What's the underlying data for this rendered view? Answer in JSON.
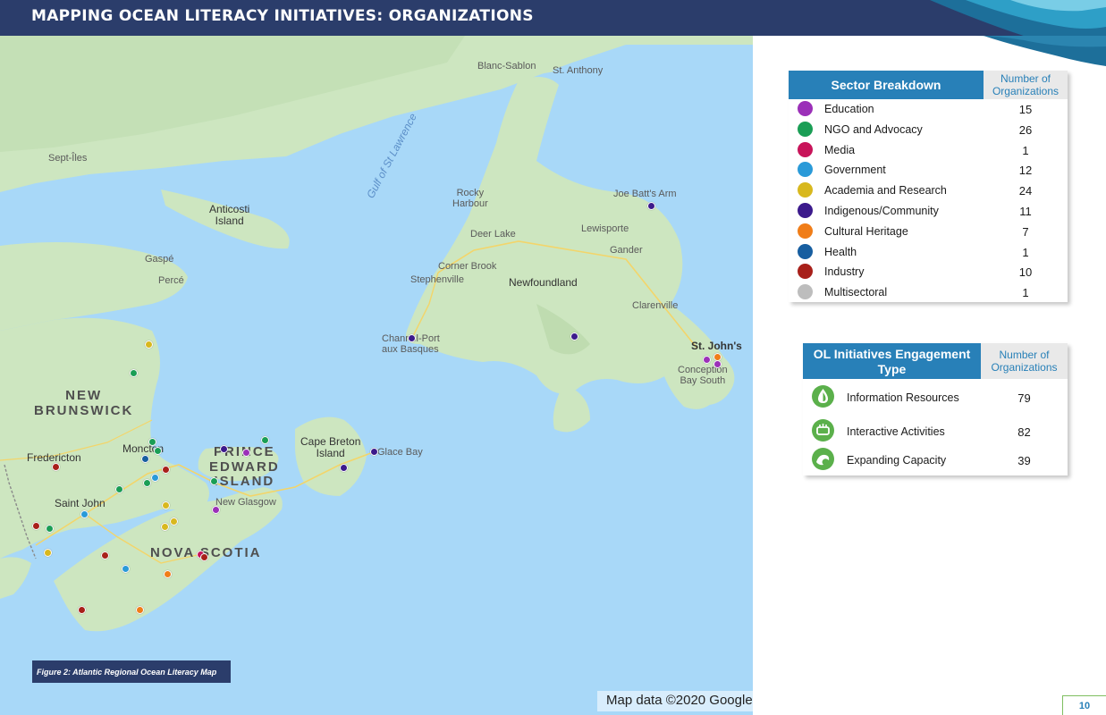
{
  "header": {
    "title": "MAPPING OCEAN LITERACY INITIATIVES: ORGANIZATIONS"
  },
  "map": {
    "labels": {
      "blanc_sablon": "Blanc-Sablon",
      "st_anthony": "St. Anthony",
      "sept_iles": "Sept-Îles",
      "anticosti": "Anticosti\nIsland",
      "gulf": "Gulf of St Lawrence",
      "rocky_harbour": "Rocky\nHarbour",
      "joe_batts_arm": "Joe Batt's Arm",
      "deer_lake": "Deer Lake",
      "lewisporte": "Lewisporte",
      "gander": "Gander",
      "gaspe": "Gaspé",
      "perce": "Percé",
      "corner_brook": "Corner Brook",
      "stephenville": "Stephenville",
      "newfoundland": "Newfoundland",
      "clarenville": "Clarenville",
      "channel_port": "Channel-Port\naux Basques",
      "st_johns": "St. John's",
      "conception_bay": "Conception\nBay South",
      "new_brunswick": "NEW\nBRUNSWICK",
      "moncton": "Moncton",
      "fredericton": "Fredericton",
      "pei": "PRINCE\nEDWARD\nISLAND",
      "cape_breton": "Cape Breton\nIsland",
      "glace_bay": "Glace Bay",
      "new_glasgow": "New Glasgow",
      "saint_john": "Saint John",
      "nova_scotia": "NOVA SCOTIA"
    },
    "caption": "Figure 2: Atlantic Regional Ocean Literacy Map",
    "attribution": "Map data ©2020 Google"
  },
  "sector_table": {
    "title": "Sector Breakdown",
    "count_header": "Number of Organizations",
    "rows": [
      {
        "label": "Education",
        "count": "15",
        "color": "#9b30b8"
      },
      {
        "label": "NGO and Advocacy",
        "count": "26",
        "color": "#1a9e55"
      },
      {
        "label": "Media",
        "count": "1",
        "color": "#c8145a"
      },
      {
        "label": "Government",
        "count": "12",
        "color": "#2a9ad8"
      },
      {
        "label": "Academia and Research",
        "count": "24",
        "color": "#d8b81e"
      },
      {
        "label": "Indigenous/Community",
        "count": "11",
        "color": "#3c1a8c"
      },
      {
        "label": "Cultural Heritage",
        "count": "7",
        "color": "#f07d18"
      },
      {
        "label": "Health",
        "count": "1",
        "color": "#175ea0"
      },
      {
        "label": "Industry",
        "count": "10",
        "color": "#a8201a"
      },
      {
        "label": "Multisectoral",
        "count": "1",
        "color": "#bdbdbd"
      }
    ]
  },
  "engagement_table": {
    "title": "OL Initiatives Engagement Type",
    "count_header": "Number of Organizations",
    "rows": [
      {
        "label": "Information Resources",
        "count": "79",
        "icon": "water-drop-icon"
      },
      {
        "label": "Interactive Activities",
        "count": "82",
        "icon": "hands-icon"
      },
      {
        "label": "Expanding Capacity",
        "count": "39",
        "icon": "wave-icon"
      }
    ]
  },
  "page_number": "10"
}
